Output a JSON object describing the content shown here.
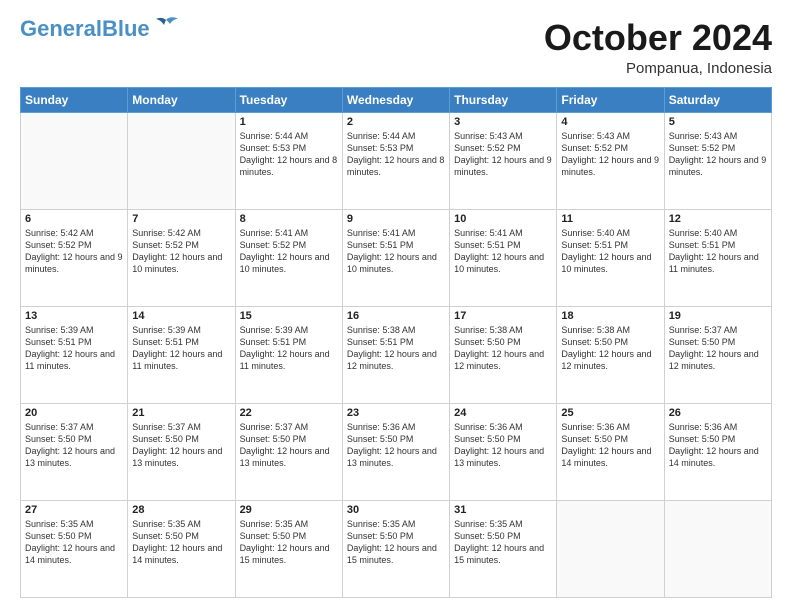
{
  "header": {
    "logo_line1": "General",
    "logo_line2": "Blue",
    "month": "October 2024",
    "location": "Pompanua, Indonesia"
  },
  "weekdays": [
    "Sunday",
    "Monday",
    "Tuesday",
    "Wednesday",
    "Thursday",
    "Friday",
    "Saturday"
  ],
  "weeks": [
    [
      {
        "day": "",
        "text": ""
      },
      {
        "day": "",
        "text": ""
      },
      {
        "day": "1",
        "text": "Sunrise: 5:44 AM\nSunset: 5:53 PM\nDaylight: 12 hours and 8 minutes."
      },
      {
        "day": "2",
        "text": "Sunrise: 5:44 AM\nSunset: 5:53 PM\nDaylight: 12 hours and 8 minutes."
      },
      {
        "day": "3",
        "text": "Sunrise: 5:43 AM\nSunset: 5:52 PM\nDaylight: 12 hours and 9 minutes."
      },
      {
        "day": "4",
        "text": "Sunrise: 5:43 AM\nSunset: 5:52 PM\nDaylight: 12 hours and 9 minutes."
      },
      {
        "day": "5",
        "text": "Sunrise: 5:43 AM\nSunset: 5:52 PM\nDaylight: 12 hours and 9 minutes."
      }
    ],
    [
      {
        "day": "6",
        "text": "Sunrise: 5:42 AM\nSunset: 5:52 PM\nDaylight: 12 hours and 9 minutes."
      },
      {
        "day": "7",
        "text": "Sunrise: 5:42 AM\nSunset: 5:52 PM\nDaylight: 12 hours and 10 minutes."
      },
      {
        "day": "8",
        "text": "Sunrise: 5:41 AM\nSunset: 5:52 PM\nDaylight: 12 hours and 10 minutes."
      },
      {
        "day": "9",
        "text": "Sunrise: 5:41 AM\nSunset: 5:51 PM\nDaylight: 12 hours and 10 minutes."
      },
      {
        "day": "10",
        "text": "Sunrise: 5:41 AM\nSunset: 5:51 PM\nDaylight: 12 hours and 10 minutes."
      },
      {
        "day": "11",
        "text": "Sunrise: 5:40 AM\nSunset: 5:51 PM\nDaylight: 12 hours and 10 minutes."
      },
      {
        "day": "12",
        "text": "Sunrise: 5:40 AM\nSunset: 5:51 PM\nDaylight: 12 hours and 11 minutes."
      }
    ],
    [
      {
        "day": "13",
        "text": "Sunrise: 5:39 AM\nSunset: 5:51 PM\nDaylight: 12 hours and 11 minutes."
      },
      {
        "day": "14",
        "text": "Sunrise: 5:39 AM\nSunset: 5:51 PM\nDaylight: 12 hours and 11 minutes."
      },
      {
        "day": "15",
        "text": "Sunrise: 5:39 AM\nSunset: 5:51 PM\nDaylight: 12 hours and 11 minutes."
      },
      {
        "day": "16",
        "text": "Sunrise: 5:38 AM\nSunset: 5:51 PM\nDaylight: 12 hours and 12 minutes."
      },
      {
        "day": "17",
        "text": "Sunrise: 5:38 AM\nSunset: 5:50 PM\nDaylight: 12 hours and 12 minutes."
      },
      {
        "day": "18",
        "text": "Sunrise: 5:38 AM\nSunset: 5:50 PM\nDaylight: 12 hours and 12 minutes."
      },
      {
        "day": "19",
        "text": "Sunrise: 5:37 AM\nSunset: 5:50 PM\nDaylight: 12 hours and 12 minutes."
      }
    ],
    [
      {
        "day": "20",
        "text": "Sunrise: 5:37 AM\nSunset: 5:50 PM\nDaylight: 12 hours and 13 minutes."
      },
      {
        "day": "21",
        "text": "Sunrise: 5:37 AM\nSunset: 5:50 PM\nDaylight: 12 hours and 13 minutes."
      },
      {
        "day": "22",
        "text": "Sunrise: 5:37 AM\nSunset: 5:50 PM\nDaylight: 12 hours and 13 minutes."
      },
      {
        "day": "23",
        "text": "Sunrise: 5:36 AM\nSunset: 5:50 PM\nDaylight: 12 hours and 13 minutes."
      },
      {
        "day": "24",
        "text": "Sunrise: 5:36 AM\nSunset: 5:50 PM\nDaylight: 12 hours and 13 minutes."
      },
      {
        "day": "25",
        "text": "Sunrise: 5:36 AM\nSunset: 5:50 PM\nDaylight: 12 hours and 14 minutes."
      },
      {
        "day": "26",
        "text": "Sunrise: 5:36 AM\nSunset: 5:50 PM\nDaylight: 12 hours and 14 minutes."
      }
    ],
    [
      {
        "day": "27",
        "text": "Sunrise: 5:35 AM\nSunset: 5:50 PM\nDaylight: 12 hours and 14 minutes."
      },
      {
        "day": "28",
        "text": "Sunrise: 5:35 AM\nSunset: 5:50 PM\nDaylight: 12 hours and 14 minutes."
      },
      {
        "day": "29",
        "text": "Sunrise: 5:35 AM\nSunset: 5:50 PM\nDaylight: 12 hours and 15 minutes."
      },
      {
        "day": "30",
        "text": "Sunrise: 5:35 AM\nSunset: 5:50 PM\nDaylight: 12 hours and 15 minutes."
      },
      {
        "day": "31",
        "text": "Sunrise: 5:35 AM\nSunset: 5:50 PM\nDaylight: 12 hours and 15 minutes."
      },
      {
        "day": "",
        "text": ""
      },
      {
        "day": "",
        "text": ""
      }
    ]
  ]
}
